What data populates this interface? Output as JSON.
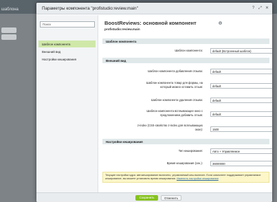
{
  "background": {
    "title_fragment": "шаблона"
  },
  "dialog": {
    "title": "Параметры компонента \"profistudio:review.main\"",
    "icons": [
      "help-icon",
      "expand-icon",
      "close-icon"
    ]
  },
  "sidebar": {
    "search_placeholder": "Поиск",
    "items": [
      {
        "label": "Шаблон компонента",
        "active": true
      },
      {
        "label": "Внешний вид",
        "active": false
      },
      {
        "label": "Настройки кеширования",
        "active": false
      }
    ]
  },
  "header": {
    "title": "BoostReviews: основной компонент",
    "subtitle": "profistudio:review.main"
  },
  "sections": {
    "template": "Шаблон компонента",
    "appearance": "Внешний вид",
    "cache": "Настройки кеширования"
  },
  "template_row": {
    "label": "Шаблон компонента:",
    "value": "default (Встроенный шаблон)"
  },
  "appearance_rows": [
    {
      "label": "Шаблон компонента добавления отзыва:",
      "value": "default"
    },
    {
      "label": "Шаблон компонента товар для формы, на который можно оставить отзыв:",
      "value": "default"
    },
    {
      "label": "Шаблон компонента удаления отзыва:",
      "value": "default"
    },
    {
      "label": "Шаблон компонента всплывающее окно с предложением добавить отзыв:",
      "value": "default"
    },
    {
      "label": "z-index (CSS-свойство z-index для всплывающих окон):",
      "value": "1500"
    }
  ],
  "cache_rows": {
    "type_label": "Тип кеширования:",
    "type_value": "Авто + Управляемое",
    "time_label": "Время кеширования (сек.):",
    "time_value": "36000000"
  },
  "note": {
    "text": "Текущие настройки ядра: автокеширование включено, управляемый кеш включен. Если компонент поддерживает управляемое кеширование, вы можете установить время кеширования.",
    "link": "Изменить настройки кеширования"
  },
  "footer": {
    "save_label": "Сохранить",
    "cancel_label": "Отменить"
  },
  "colors": {
    "accent": "#86c21f",
    "active_nav": "#cfe8a8",
    "section_bg": "#e0e8ea",
    "note_bg": "#fcf6c9"
  }
}
